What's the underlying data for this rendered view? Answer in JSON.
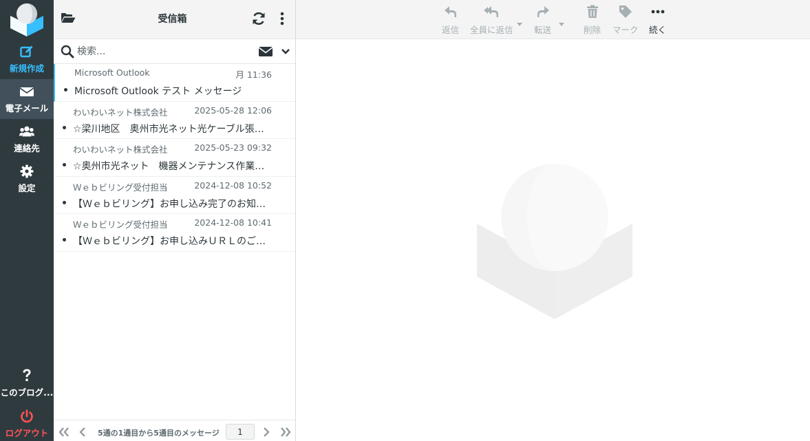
{
  "sidebar": {
    "compose_label": "新規作成",
    "mail_label": "電子メール",
    "contacts_label": "連絡先",
    "settings_label": "設定",
    "about_label": "このブログ...",
    "logout_label": "ログアウト"
  },
  "list_header": {
    "title": "受信箱"
  },
  "search": {
    "placeholder": "検索..."
  },
  "messages": [
    {
      "from": "Microsoft Outlook",
      "date": "月 11:36",
      "subject": "Microsoft Outlook テスト メッセージ"
    },
    {
      "from": "わいわいネット株式会社",
      "date": "2025-05-28 12:06",
      "subject": "☆梁川地区　奥州市光ネット光ケーブル張替工事のお知らせ"
    },
    {
      "from": "わいわいネット株式会社",
      "date": "2025-05-23 09:32",
      "subject": "☆奥州市光ネット　機器メンテナンス作業のお知らせ"
    },
    {
      "from": "Ｗｅｂビリング受付担当",
      "date": "2024-12-08 10:52",
      "subject": "【Ｗｅｂビリング】お申し込み完了のお知らせ"
    },
    {
      "from": "Ｗｅｂビリング受付担当",
      "date": "2024-12-08 10:41",
      "subject": "【Ｗｅｂビリング】お申し込みＵＲＬのご案内"
    }
  ],
  "pagination": {
    "text": "5通の1通目から5通目のメッセージ",
    "page": "1"
  },
  "toolbar": {
    "reply_label": "返信",
    "reply_all_label": "全員に返信",
    "forward_label": "転送",
    "delete_label": "削除",
    "mark_label": "マーク",
    "more_label": "続く"
  },
  "colors": {
    "sidebar_bg": "#2f3a3f",
    "accent": "#37beff",
    "logout": "#ff5552"
  }
}
